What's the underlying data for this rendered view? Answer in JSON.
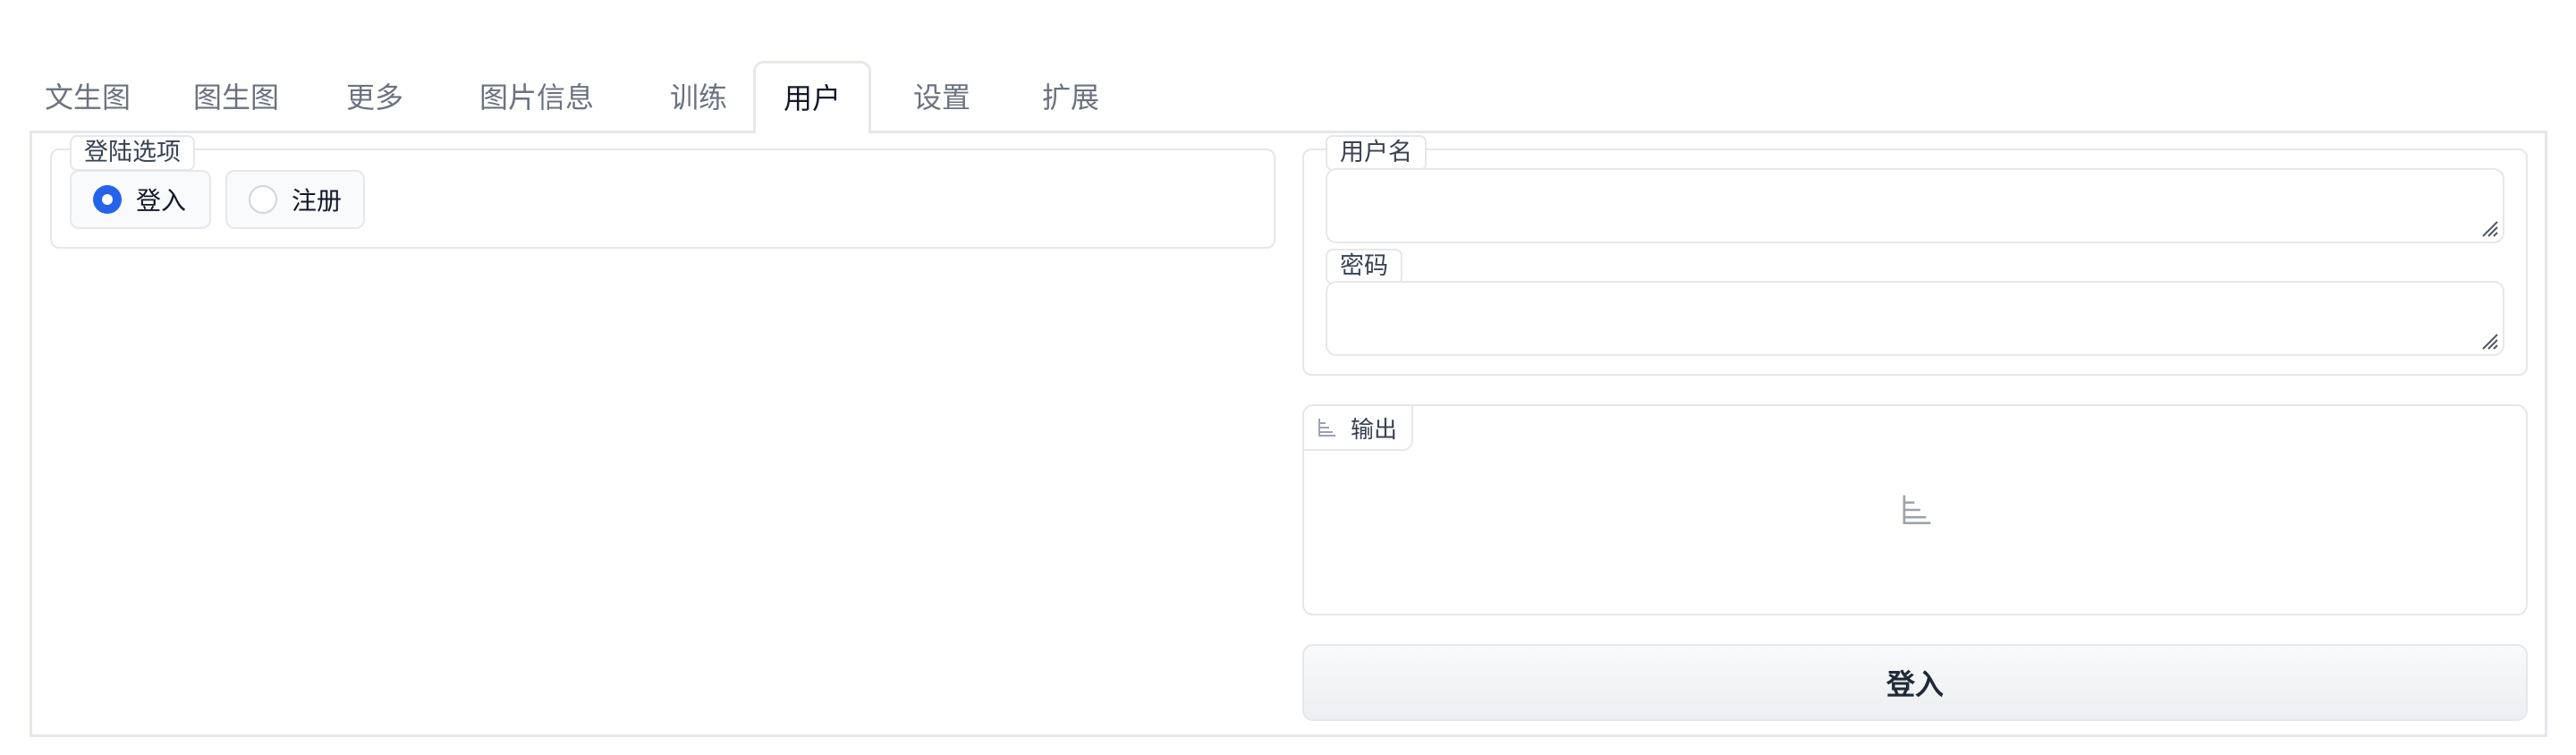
{
  "tabs": [
    {
      "label": "文生图"
    },
    {
      "label": "图生图"
    },
    {
      "label": "更多"
    },
    {
      "label": "图片信息"
    },
    {
      "label": "训练"
    },
    {
      "label": "用户",
      "active": true
    },
    {
      "label": "设置"
    },
    {
      "label": "扩展"
    }
  ],
  "login_options": {
    "title": "登陆选项",
    "selected": "登入",
    "options": [
      "登入",
      "注册"
    ]
  },
  "credentials": {
    "username_label": "用户名",
    "username_value": "",
    "password_label": "密码",
    "password_value": ""
  },
  "output": {
    "label": "输出",
    "icon": "json-tree-icon"
  },
  "login_button": "登入",
  "colors": {
    "accent": "#2563eb",
    "border": "#e5e7eb",
    "muted_text": "#6b7280"
  }
}
